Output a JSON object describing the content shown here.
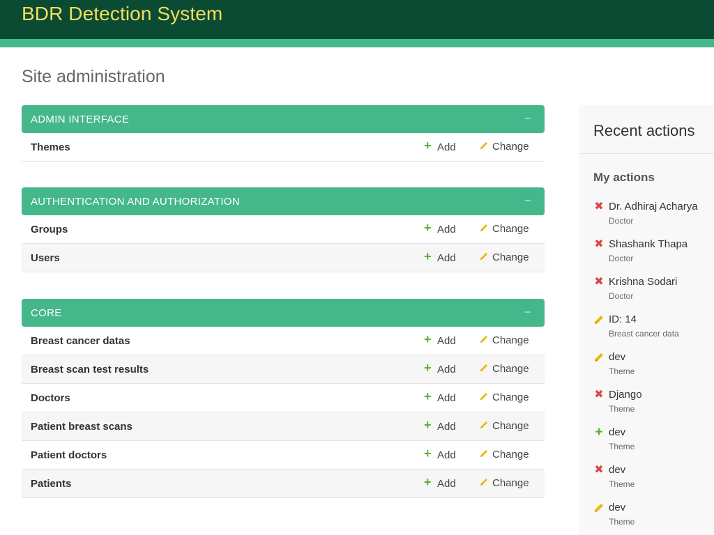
{
  "header": {
    "brand": "BDR Detection System"
  },
  "page": {
    "title": "Site administration"
  },
  "labels": {
    "add": "Add",
    "change": "Change",
    "collapse": "–"
  },
  "modules": [
    {
      "caption": "ADMIN INTERFACE",
      "models": [
        "Themes"
      ]
    },
    {
      "caption": "AUTHENTICATION AND AUTHORIZATION",
      "models": [
        "Groups",
        "Users"
      ]
    },
    {
      "caption": "CORE",
      "models": [
        "Breast cancer datas",
        "Breast scan test results",
        "Doctors",
        "Patient breast scans",
        "Patient doctors",
        "Patients"
      ]
    }
  ],
  "recent": {
    "title": "Recent actions",
    "my_actions": "My actions",
    "items": [
      {
        "action": "delete",
        "name": "Dr. Adhiraj Acharya",
        "type": "Doctor"
      },
      {
        "action": "delete",
        "name": "Shashank Thapa",
        "type": "Doctor"
      },
      {
        "action": "delete",
        "name": "Krishna Sodari",
        "type": "Doctor"
      },
      {
        "action": "change",
        "name": "ID: 14",
        "type": "Breast cancer data"
      },
      {
        "action": "change",
        "name": "dev",
        "type": "Theme"
      },
      {
        "action": "delete",
        "name": "Django",
        "type": "Theme"
      },
      {
        "action": "add",
        "name": "dev",
        "type": "Theme"
      },
      {
        "action": "delete",
        "name": "dev",
        "type": "Theme"
      },
      {
        "action": "change",
        "name": "dev",
        "type": "Theme"
      }
    ]
  },
  "colors": {
    "header": "#0c4b33",
    "brand": "#f5dd5d",
    "accent": "#44b78b",
    "add": "#5bb030",
    "delete": "#dd4646",
    "change": "#efb80b"
  }
}
